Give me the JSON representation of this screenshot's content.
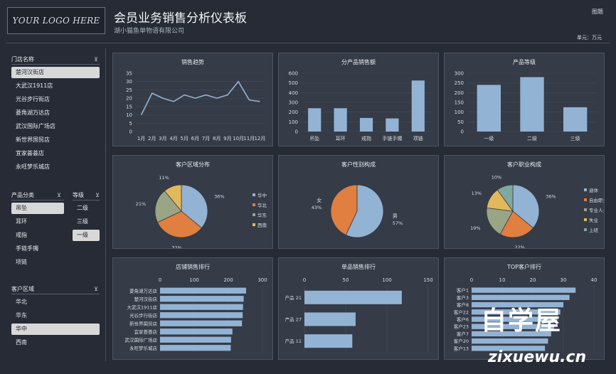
{
  "header": {
    "logo_text": "YOUR LOGO HERE",
    "title": "会员业务销售分析仪表板",
    "subtitle": "湖小猫鱼单物语有限公司",
    "top_right": "图题",
    "unit": "单元：万元"
  },
  "slicers": {
    "store": {
      "title": "门店名称",
      "items": [
        "楚河汉街店",
        "大武汉1911店",
        "光谷步行街店",
        "菱角湖万达店",
        "武汉国际广场店",
        "新世界国贸店",
        "宜家荟荟店",
        "永旺梦乐城店"
      ],
      "selected": [
        0
      ]
    },
    "category": {
      "title": "产品分类",
      "items": [
        "吊坠",
        "耳环",
        "戒指",
        "手链手镯",
        "项链"
      ],
      "selected": [
        0
      ]
    },
    "grade": {
      "title": "等级",
      "items": [
        "二级",
        "三级",
        "一级"
      ],
      "selected": [
        2
      ]
    },
    "region": {
      "title": "客户区域",
      "items": [
        "华北",
        "华东",
        "华中",
        "西南"
      ],
      "selected": [
        2
      ]
    }
  },
  "colors": {
    "bar": "#93b3d4",
    "series": [
      "#93b3d4",
      "#e07f3f",
      "#9aa585",
      "#e3b85a",
      "#7fa9a0"
    ]
  },
  "chart_data": [
    {
      "id": "trend",
      "type": "line",
      "title": "销售趋势",
      "categories": [
        "1月",
        "2月",
        "3月",
        "4月",
        "5月",
        "6月",
        "7月",
        "8月",
        "9月",
        "10月",
        "11月",
        "12月"
      ],
      "values": [
        10,
        23,
        20,
        18,
        22,
        20,
        22,
        20,
        22,
        30,
        19,
        18
      ],
      "ylim": [
        0,
        35
      ],
      "yticks": [
        0,
        5,
        10,
        15,
        20,
        25,
        30,
        35
      ]
    },
    {
      "id": "product",
      "type": "bar",
      "title": "分产品销售额",
      "categories": [
        "吊坠",
        "耳环",
        "戒指",
        "手链手镯",
        "项链"
      ],
      "values": [
        240,
        240,
        140,
        135,
        525
      ],
      "ylim": [
        0,
        600
      ],
      "yticks": [
        0,
        100,
        200,
        300,
        400,
        500,
        600
      ]
    },
    {
      "id": "level",
      "type": "bar",
      "title": "产品等级",
      "categories": [
        "一级",
        "二级",
        "三级"
      ],
      "values": [
        240,
        280,
        125
      ],
      "ylim": [
        0,
        300
      ],
      "yticks": [
        0,
        50,
        100,
        150,
        200,
        250,
        300
      ]
    },
    {
      "id": "region",
      "type": "pie",
      "title": "客户区域分布",
      "labels": [
        "华中",
        "华北",
        "华东",
        "西南"
      ],
      "values": [
        36,
        32,
        21,
        11
      ],
      "pct_labels": [
        "36%",
        "32%",
        "21%",
        "11%"
      ],
      "legend": "right"
    },
    {
      "id": "gender",
      "type": "pie",
      "title": "客户性别构成",
      "labels": [
        "男",
        "女"
      ],
      "values": [
        57,
        43
      ],
      "pct_labels": [
        "57%",
        "43%"
      ]
    },
    {
      "id": "job",
      "type": "pie",
      "title": "客户职业构成",
      "labels": [
        "退休",
        "自由职业",
        "专业人士",
        "失业",
        "上班"
      ],
      "values": [
        36,
        22,
        19,
        13,
        10
      ],
      "pct_labels": [
        "36%",
        "22%",
        "19%",
        "13%",
        "10%"
      ],
      "legend": "right"
    },
    {
      "id": "store_rank",
      "type": "bar",
      "orientation": "horizontal",
      "title": "店铺销售排行",
      "categories": [
        "菱角湖万达店",
        "楚河汉街店",
        "大武汉1911店",
        "光谷步行街店",
        "新世界国贸店",
        "宜家荟荟店",
        "武汉国际广场店",
        "永旺梦乐城店"
      ],
      "values": [
        252,
        245,
        243,
        242,
        240,
        212,
        208,
        207
      ],
      "xlim": [
        0,
        300
      ],
      "xticks": [
        0,
        100,
        200,
        300
      ]
    },
    {
      "id": "product_rank",
      "type": "bar",
      "orientation": "horizontal",
      "title": "单品销售排行",
      "categories": [
        "产品 21",
        "产品 27",
        "产品 11"
      ],
      "values": [
        118,
        62,
        58
      ],
      "xlim": [
        0,
        150
      ],
      "xticks": [
        0,
        50,
        100,
        150
      ]
    },
    {
      "id": "top_customers",
      "type": "bar",
      "orientation": "horizontal",
      "title": "TOP客户排行",
      "categories": [
        "客户1",
        "客户3",
        "客户8",
        "客户22",
        "客户6",
        "客户23",
        "客户7",
        "客户20",
        "客户13"
      ],
      "values": [
        34,
        32,
        30,
        29,
        28,
        27,
        26,
        25,
        24
      ],
      "xlim": [
        0,
        40
      ],
      "xticks": [
        0,
        10,
        20,
        30,
        40
      ]
    }
  ],
  "watermark": {
    "line1": "自学屋",
    "line2": "zixuewu.cn"
  }
}
